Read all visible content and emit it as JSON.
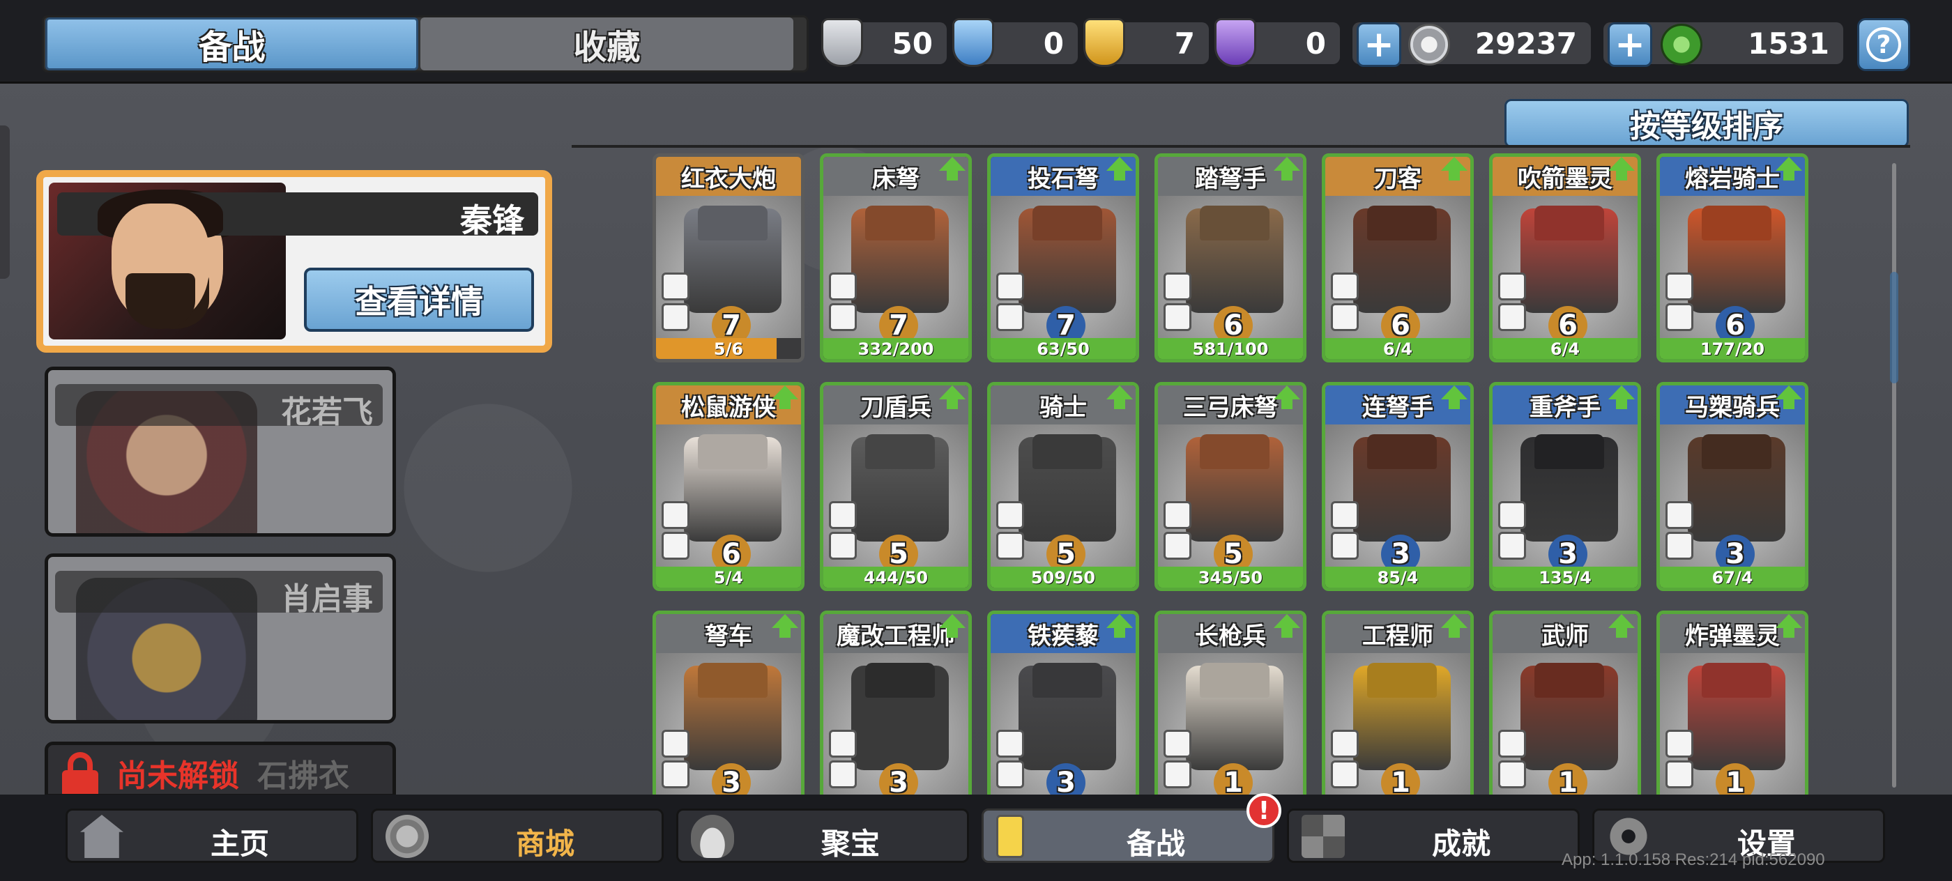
{
  "top_tabs": [
    {
      "label": "备战",
      "active": true
    },
    {
      "label": "收藏",
      "active": false
    }
  ],
  "currencies": [
    {
      "icon": "silver-shield-icon",
      "value": "50",
      "color": "#c9ccd1"
    },
    {
      "icon": "blue-shield-icon",
      "value": "0",
      "color": "#6aa9e8"
    },
    {
      "icon": "gold-shield-icon",
      "value": "7",
      "color": "#e6b22a"
    },
    {
      "icon": "purple-shield-icon",
      "value": "0",
      "color": "#8d5fd0"
    }
  ],
  "coins": {
    "icon": "silver-coin-icon",
    "value": "29237"
  },
  "jade": {
    "icon": "jade-coin-icon",
    "value": "1531"
  },
  "help_label": "?",
  "sort_label": "按等级排序",
  "main_hero": {
    "name": "秦锋",
    "detail_label": "查看详情"
  },
  "other_heroes": [
    {
      "name": "花若飞"
    },
    {
      "name": "肖启事"
    }
  ],
  "locked_hero": {
    "status": "尚未解锁",
    "name": "石拂衣"
  },
  "units": [
    {
      "name": "红衣大炮",
      "level": "7",
      "progress": "5/6",
      "fill": 0.83,
      "header": "#c98a3a",
      "border": "#5b5b5b",
      "upgrade": false,
      "art": "#7a7d85"
    },
    {
      "name": "床弩",
      "level": "7",
      "progress": "332/200",
      "fill": 1,
      "header": "#6f7275",
      "border": "#57a83a",
      "upgrade": true,
      "art": "#b0623a"
    },
    {
      "name": "投石弩",
      "level": "7",
      "progress": "63/50",
      "fill": 1,
      "header": "#3d6db4",
      "border": "#57a83a",
      "upgrade": true,
      "art": "#a05636"
    },
    {
      "name": "踏弩手",
      "level": "6",
      "progress": "581/100",
      "fill": 1,
      "header": "#6f7275",
      "border": "#57a83a",
      "upgrade": true,
      "art": "#8a6a4a"
    },
    {
      "name": "刀客",
      "level": "6",
      "progress": "6/4",
      "fill": 1,
      "header": "#c98a3a",
      "border": "#57a83a",
      "upgrade": true,
      "art": "#6a3a2a"
    },
    {
      "name": "吹箭墨灵",
      "level": "6",
      "progress": "6/4",
      "fill": 1,
      "header": "#c98a3a",
      "border": "#57a83a",
      "upgrade": true,
      "art": "#c0443a"
    },
    {
      "name": "熔岩骑士",
      "level": "6",
      "progress": "177/20",
      "fill": 1,
      "header": "#3d6db4",
      "border": "#57a83a",
      "upgrade": true,
      "art": "#d0562a"
    },
    {
      "name": "松鼠游侠",
      "level": "6",
      "progress": "5/4",
      "fill": 1,
      "header": "#c98a3a",
      "border": "#57a83a",
      "upgrade": true,
      "art": "#e8e0d8"
    },
    {
      "name": "刀盾兵",
      "level": "5",
      "progress": "444/50",
      "fill": 1,
      "header": "#6f7275",
      "border": "#57a83a",
      "upgrade": true,
      "art": "#5c5c5c"
    },
    {
      "name": "骑士",
      "level": "5",
      "progress": "509/50",
      "fill": 1,
      "header": "#6f7275",
      "border": "#57a83a",
      "upgrade": true,
      "art": "#4d4d4d"
    },
    {
      "name": "三弓床弩",
      "level": "5",
      "progress": "345/50",
      "fill": 1,
      "header": "#6f7275",
      "border": "#57a83a",
      "upgrade": true,
      "art": "#b0623a"
    },
    {
      "name": "连弩手",
      "level": "3",
      "progress": "85/4",
      "fill": 1,
      "header": "#3d6db4",
      "border": "#57a83a",
      "upgrade": true,
      "art": "#6a3a2a"
    },
    {
      "name": "重斧手",
      "level": "3",
      "progress": "135/4",
      "fill": 1,
      "header": "#3d6db4",
      "border": "#57a83a",
      "upgrade": true,
      "art": "#2e2e30"
    },
    {
      "name": "马槊骑兵",
      "level": "3",
      "progress": "67/4",
      "fill": 1,
      "header": "#3d6db4",
      "border": "#57a83a",
      "upgrade": true,
      "art": "#5a3a2a"
    },
    {
      "name": "弩车",
      "level": "3",
      "progress": "",
      "fill": 0,
      "header": "#6f7275",
      "border": "#57a83a",
      "upgrade": true,
      "art": "#c0783a"
    },
    {
      "name": "魔改工程师",
      "level": "3",
      "progress": "",
      "fill": 0,
      "header": "#6f7275",
      "border": "#57a83a",
      "upgrade": true,
      "art": "#3a3a3a"
    },
    {
      "name": "铁蒺藜",
      "level": "3",
      "progress": "",
      "fill": 0,
      "header": "#3d6db4",
      "border": "#57a83a",
      "upgrade": true,
      "art": "#4a4a4d"
    },
    {
      "name": "长枪兵",
      "level": "1",
      "progress": "",
      "fill": 0,
      "header": "#6f7275",
      "border": "#57a83a",
      "upgrade": true,
      "art": "#e4dcd0"
    },
    {
      "name": "工程师",
      "level": "1",
      "progress": "",
      "fill": 0,
      "header": "#6f7275",
      "border": "#57a83a",
      "upgrade": true,
      "art": "#e0a828"
    },
    {
      "name": "武师",
      "level": "1",
      "progress": "",
      "fill": 0,
      "header": "#6f7275",
      "border": "#57a83a",
      "upgrade": true,
      "art": "#8a3a2a"
    },
    {
      "name": "炸弹墨灵",
      "level": "1",
      "progress": "",
      "fill": 0,
      "header": "#6f7275",
      "border": "#57a83a",
      "upgrade": true,
      "art": "#c0443a"
    }
  ],
  "nav": [
    {
      "label": "主页",
      "icon": "home-icon",
      "active": false,
      "gold": false
    },
    {
      "label": "商城",
      "icon": "shop-coins-icon",
      "active": false,
      "gold": true
    },
    {
      "label": "聚宝",
      "icon": "treasure-bowl-icon",
      "active": false,
      "gold": false
    },
    {
      "label": "备战",
      "icon": "card-deck-icon",
      "active": true,
      "gold": false
    },
    {
      "label": "成就",
      "icon": "achievement-grid-icon",
      "active": false,
      "gold": false
    },
    {
      "label": "设置",
      "icon": "gear-icon",
      "active": false,
      "gold": false
    }
  ],
  "alert_badge": "!",
  "app_info": "App: 1.1.0.158 Res:214 pid:562090"
}
